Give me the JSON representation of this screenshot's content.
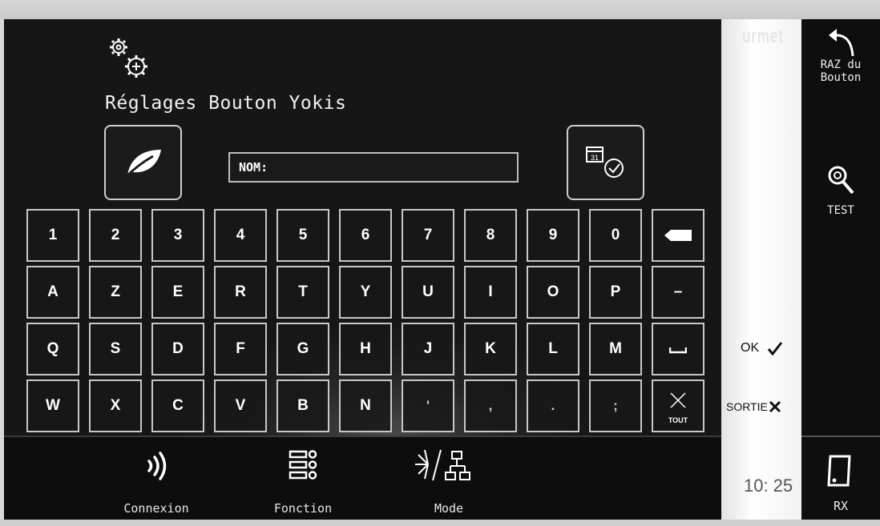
{
  "header": {
    "title": "Réglages Bouton Yokis"
  },
  "name_field": {
    "label": "NOM:"
  },
  "keyboard": {
    "rows": [
      [
        "1",
        "2",
        "3",
        "4",
        "5",
        "6",
        "7",
        "8",
        "9",
        "0"
      ],
      [
        "A",
        "Z",
        "E",
        "R",
        "T",
        "Y",
        "U",
        "I",
        "O",
        "P",
        "–"
      ],
      [
        "Q",
        "S",
        "D",
        "F",
        "G",
        "H",
        "J",
        "K",
        "L",
        "M"
      ],
      [
        "W",
        "X",
        "C",
        "V",
        "B",
        "N",
        "'",
        ",",
        ".",
        ";"
      ]
    ],
    "clear_all_label": "TOUT"
  },
  "bottom_nav": {
    "connexion": "Connexion",
    "fonction": "Fonction",
    "mode": "Mode"
  },
  "strip": {
    "brand": "urmet",
    "ok_label": "OK",
    "exit_label": "SORTIE",
    "clock": "10: 25"
  },
  "right_panel": {
    "reset_line1": "RAZ du",
    "reset_line2": "Bouton",
    "test_label": "TEST",
    "rx_label": "RX"
  },
  "colors": {
    "screen_background": "#161616",
    "key_border": "#c8c8c8",
    "strip_background": "#ffffff"
  }
}
